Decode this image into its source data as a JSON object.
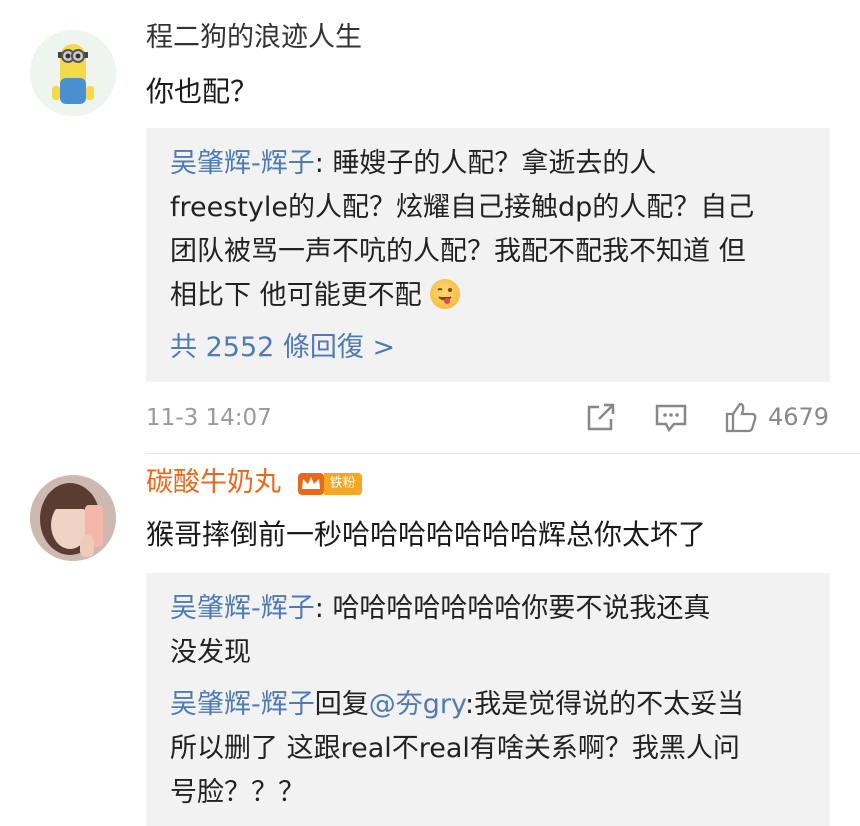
{
  "comments": [
    {
      "username": "程二狗的浪迹人生",
      "text": "你也配？",
      "replies": [
        {
          "author": "吴肇辉-辉子",
          "sep": ": ",
          "lines": [
            "睡嫂子的人配？拿逝去的人",
            "freestyle的人配？炫耀自己接触dp的人配？自己",
            "团队被骂一声不吭的人配？我配不配我不知道 但",
            "相比下 他可能更不配"
          ],
          "emoji": "wink-tongue-emoji"
        }
      ],
      "reply_count_label": "共 2552 條回復 >",
      "timestamp": "11-3 14:07",
      "like_count": "4679"
    },
    {
      "username": "碳酸牛奶丸",
      "badge_label": "铁粉",
      "text": "猴哥摔倒前一秒哈哈哈哈哈哈哈辉总你太坏了",
      "replies": [
        {
          "author": "吴肇辉-辉子",
          "sep": ": ",
          "lines": [
            "哈哈哈哈哈哈哈你要不说我还真",
            "没发现"
          ]
        },
        {
          "author": "吴肇辉-辉子",
          "reply_word": "回复",
          "mention": "@夯gry",
          "lines": [
            "我是觉得说的不太妥当",
            "所以删了 这跟real不real有啥关系啊？我黑人问",
            "号脸？？？"
          ]
        }
      ]
    }
  ],
  "colors": {
    "link_blue": "#4f7bb5",
    "orange_username": "#e8691c",
    "reply_bg": "#f2f2f2"
  }
}
